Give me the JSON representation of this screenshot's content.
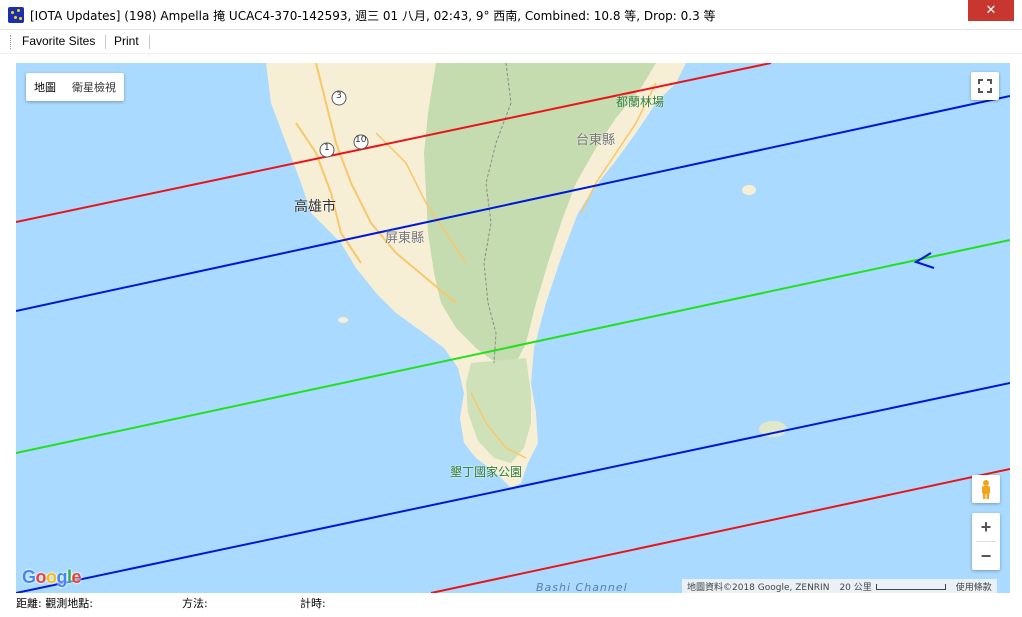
{
  "window": {
    "title": "[IOTA Updates] (198) Ampella 掩 UCAC4-370-142593, 週三 01 八月, 02:43, 9° 西南, Combined: 10.8 等, Drop:  0.3 等",
    "close_label": "✕",
    "icon": "star-globe-icon"
  },
  "menu": {
    "items": [
      {
        "label": "Favorite Sites"
      },
      {
        "label": "Print"
      }
    ]
  },
  "map": {
    "type_buttons": [
      {
        "label": "地圖"
      },
      {
        "label": "衛星檢視"
      }
    ],
    "labels": {
      "kaohsiung": "高雄市",
      "pingtung": "屏東縣",
      "taitung": "台東縣",
      "airport": "都蘭林場",
      "park": "墾丁國家公園",
      "channel": "Bashi Channel",
      "road_3": "3",
      "road_1": "1",
      "road_10": "10"
    },
    "google_logo": "Google",
    "attribution": "地圖資料©2018 Google, ZENRIN",
    "scale_label": "20 公里",
    "terms": "使用條款",
    "zoom_in_label": "+",
    "zoom_out_label": "−",
    "colors": {
      "sea": "#aadaff",
      "land": "#f6efd6",
      "forest": "#c5dbb0",
      "path_limit": "#e8161a",
      "path_edge": "#0018d8",
      "path_center": "#22e01a",
      "road": "#f8c76a"
    }
  },
  "status": {
    "distance_label": "距離: 觀測地點:",
    "method_label": "方法:",
    "time_label": "計時:"
  }
}
